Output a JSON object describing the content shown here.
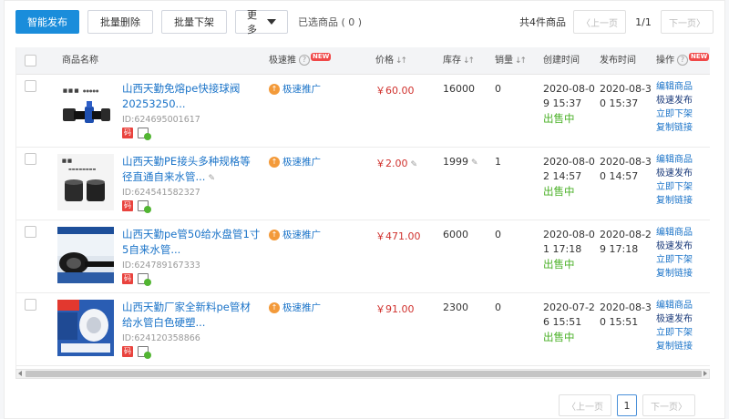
{
  "toolbar": {
    "smart_publish": "智能发布",
    "batch_delete": "批量删除",
    "batch_delist": "批量下架",
    "more": "更多",
    "selected": "已选商品 ( 0 )"
  },
  "pager": {
    "total": "共4件商品",
    "prev": "上一页",
    "next": "下一页",
    "page_info": "1/1",
    "current": "1"
  },
  "columns": {
    "name": "商品名称",
    "promo": "极速推",
    "price": "价格",
    "stock": "库存",
    "sales": "销量",
    "created": "创建时间",
    "published": "发布时间",
    "ops": "操作",
    "new_badge": "NEW"
  },
  "row_common": {
    "promo_label": "极速推广",
    "tag_label": "码",
    "op_edit": "编辑商品",
    "op_fast_publish": "极速发布",
    "op_delist": "立即下架",
    "op_copy_link": "复制链接"
  },
  "products": [
    {
      "title": "山西天勤免熔pe快接球阀20253250...",
      "id": "ID:624695001617",
      "price": "￥60.00",
      "stock": "16000",
      "sales": "0",
      "created": "2020-08-09 15:37",
      "published": "2020-08-30 15:37",
      "status": "出售中"
    },
    {
      "title": "山西天勤PE接头多种规格等径直通自来水管...",
      "id": "ID:624541582327",
      "price": "￥2.00",
      "stock": "1999",
      "sales": "1",
      "created": "2020-08-02 14:57",
      "published": "2020-08-30 14:57",
      "status": "出售中"
    },
    {
      "title": "山西天勤pe管50给水盘管1寸5自来水管...",
      "id": "ID:624789167333",
      "price": "￥471.00",
      "stock": "6000",
      "sales": "0",
      "created": "2020-08-01 17:18",
      "published": "2020-08-29 17:18",
      "status": "出售中"
    },
    {
      "title": "山西天勤厂家全新料pe管材给水管白色硬塑...",
      "id": "ID:624120358866",
      "price": "￥91.00",
      "stock": "2300",
      "sales": "0",
      "created": "2020-07-26 15:51",
      "published": "2020-08-30 15:51",
      "status": "出售中"
    }
  ]
}
